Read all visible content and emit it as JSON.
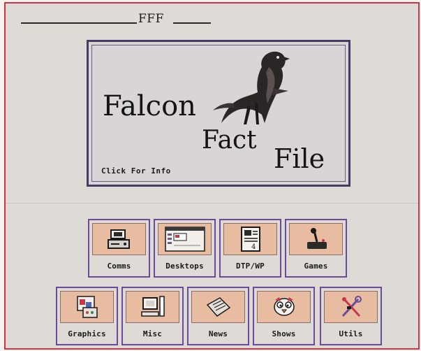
{
  "window": {
    "title": "FFF"
  },
  "splash": {
    "logo_line1": "Falcon",
    "logo_line2": "Fact",
    "logo_line3": "File",
    "click_label": "Click For Info"
  },
  "icons_row1": [
    {
      "label": "Comms",
      "icon": "modem-icon"
    },
    {
      "label": "Desktops",
      "icon": "desktop-window-icon"
    },
    {
      "label": "DTP/WP",
      "icon": "document-page-icon"
    },
    {
      "label": "Games",
      "icon": "joystick-icon"
    }
  ],
  "icons_row2": [
    {
      "label": "Graphics",
      "icon": "paint-palette-icon"
    },
    {
      "label": "Misc",
      "icon": "computer-icon"
    },
    {
      "label": "News",
      "icon": "newspaper-icon"
    },
    {
      "label": "Shows",
      "icon": "cartoon-character-icon"
    },
    {
      "label": "Utils",
      "icon": "tools-icon"
    }
  ],
  "colors": {
    "window_border": "#c23a4a",
    "panel_border": "#4a3a68",
    "button_border": "#6a4a9a",
    "button_pad": "#e7bca0",
    "background": "#dedad6"
  }
}
